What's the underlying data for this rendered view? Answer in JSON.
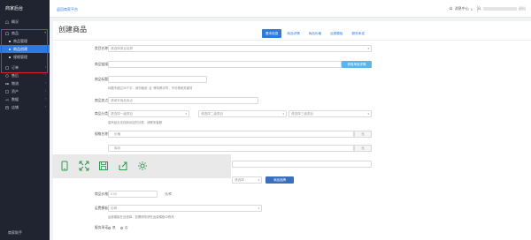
{
  "app": {
    "brand": "商家后台",
    "top_link": "返回商家平台",
    "messages_label": "消息中心",
    "messages_count": "1",
    "user_prefix": "",
    "user_suffix": "退出"
  },
  "sidebar": {
    "items": [
      {
        "label": "概况",
        "icon": "home-icon"
      },
      {
        "label": "商品",
        "icon": "goods-icon",
        "expanded": true
      },
      {
        "label": "商品管理",
        "sub": true
      },
      {
        "label": "商品创建",
        "sub": true,
        "active": true
      },
      {
        "label": "规格管理",
        "sub": true
      },
      {
        "label": "订单",
        "icon": "order-icon"
      },
      {
        "label": "售后",
        "icon": "aftersale-icon"
      },
      {
        "label": "物流",
        "icon": "logistics-icon"
      },
      {
        "label": "资产",
        "icon": "asset-icon"
      },
      {
        "label": "数据",
        "icon": "data-icon"
      },
      {
        "label": "店铺",
        "icon": "shop-icon"
      }
    ],
    "bottom": "商家助手"
  },
  "page": {
    "title": "创建商品",
    "tabs": [
      "基本信息",
      "商品详情",
      "商品价格",
      "运费模板",
      "服务承诺"
    ]
  },
  "form": {
    "category_label": "类目名称",
    "category_placeholder": "请选择类目名称",
    "link_label": "商品链接",
    "link_button": "获取淘宝详情",
    "title_label": "商品标题",
    "title_hint": "标题不超过30个字，请勿使用【】等特殊字符，不可堆砌关键词",
    "selling_label": "商品卖点",
    "selling_placeholder": "请填写商品卖点",
    "cat_select_label": "商品分类",
    "cat_level1": "请选择一级类目",
    "cat_level2": "请选择二级类目",
    "cat_level3": "请选择三级类目",
    "cat_hint": "若商品无法找到对应的分类，请联系客服",
    "spec_label": "规格名称",
    "spec_rows": [
      "价格",
      "库存"
    ],
    "spec_addon": "元",
    "brand_button": "添加品牌",
    "brand_placeholder": "请选择",
    "price_label": "商品价格",
    "price_value": "0.00",
    "price_unit": "元/件",
    "freight_label": "运费模板",
    "freight_value": "包邮",
    "freight_hint": "运费模板在此选择，如需修改请在运费模板中修改",
    "service_label": "服务承诺",
    "service_options": [
      "是",
      "否"
    ]
  },
  "toolbar_icons": [
    "phone-icon",
    "expand-icon",
    "save-icon",
    "share-icon",
    "settings-icon"
  ],
  "colors": {
    "sidebar_bg": "#1f2430",
    "accent": "#2d7be0",
    "highlight": "#e0242c"
  }
}
